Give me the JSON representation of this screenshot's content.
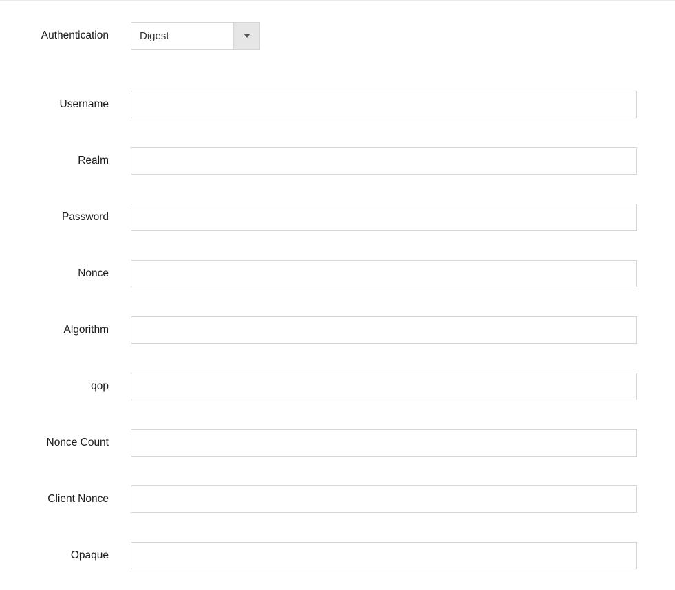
{
  "authentication": {
    "label": "Authentication",
    "selected_value": "Digest"
  },
  "fields": {
    "username": {
      "label": "Username",
      "value": ""
    },
    "realm": {
      "label": "Realm",
      "value": ""
    },
    "password": {
      "label": "Password",
      "value": ""
    },
    "nonce": {
      "label": "Nonce",
      "value": ""
    },
    "algorithm": {
      "label": "Algorithm",
      "value": ""
    },
    "qop": {
      "label": "qop",
      "value": ""
    },
    "nonce_count": {
      "label": "Nonce Count",
      "value": ""
    },
    "client_nonce": {
      "label": "Client Nonce",
      "value": ""
    },
    "opaque": {
      "label": "Opaque",
      "value": ""
    }
  }
}
